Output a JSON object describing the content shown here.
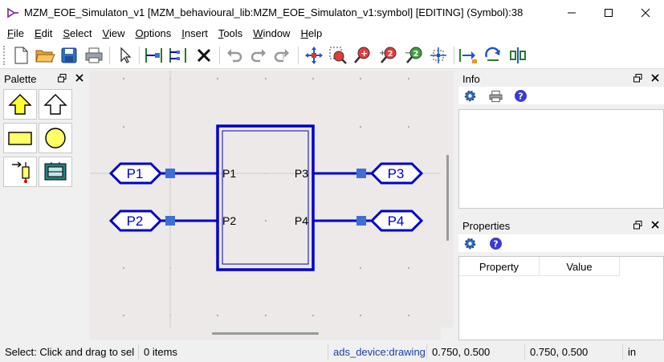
{
  "window": {
    "title": "MZM_EOE_Simulaton_v1 [MZM_behavioural_lib:MZM_EOE_Simulaton_v1:symbol] [EDITING] (Symbol):38"
  },
  "menu": [
    {
      "label": "File",
      "ul": "F",
      "rest": "ile"
    },
    {
      "label": "Edit",
      "ul": "E",
      "rest": "dit"
    },
    {
      "label": "Select",
      "ul": "S",
      "rest": "elect"
    },
    {
      "label": "View",
      "ul": "V",
      "rest": "iew"
    },
    {
      "label": "Options",
      "ul": "O",
      "rest": "ptions"
    },
    {
      "label": "Insert",
      "ul": "I",
      "rest": "nsert"
    },
    {
      "label": "Tools",
      "ul": "T",
      "rest": "ools"
    },
    {
      "label": "Window",
      "ul": "W",
      "rest": "indow"
    },
    {
      "label": "Help",
      "ul": "H",
      "rest": "elp"
    }
  ],
  "palette": {
    "title": "Palette"
  },
  "info": {
    "title": "Info"
  },
  "properties": {
    "title": "Properties",
    "columns": [
      "Property",
      "Value"
    ]
  },
  "symbol": {
    "pins": {
      "p1_port": "P1",
      "p2_port": "P2",
      "p3_port": "P3",
      "p4_port": "P4",
      "p1_box": "P1",
      "p2_box": "P2",
      "p3_box": "P3",
      "p4_box": "P4"
    }
  },
  "status": {
    "message": "Select: Click and drag to sel",
    "items": "0 items",
    "layer": "ads_device:drawing",
    "coord1": "0.750, 0.500",
    "coord2": "0.750, 0.500",
    "unit": "in"
  },
  "colors": {
    "wire": "#0000c8",
    "pin_square": "#3d6fd6",
    "canvas": "#ece9e8",
    "palette_fill": "#ffff66"
  }
}
